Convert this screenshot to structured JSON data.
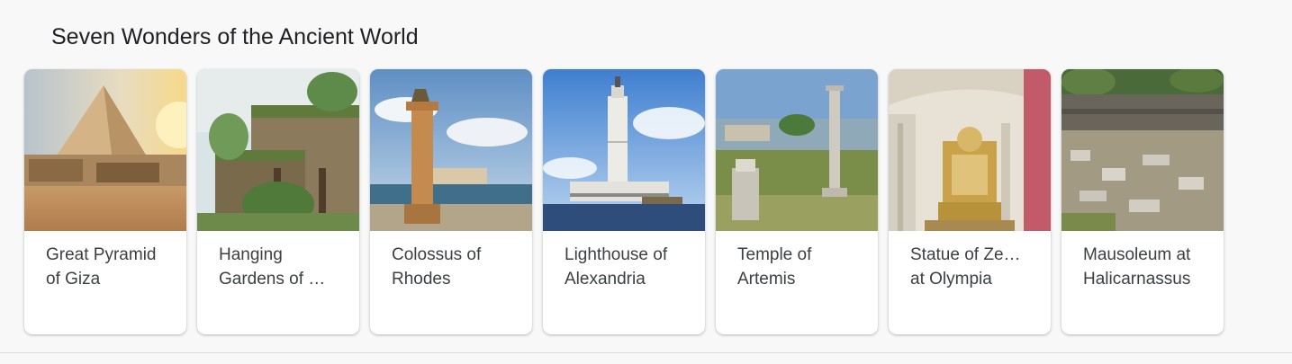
{
  "section": {
    "title": "Seven Wonders of the Ancient World"
  },
  "cards": [
    {
      "line1": "Great Pyramid",
      "line2": "of Giza",
      "image": "great-pyramid-image"
    },
    {
      "line1": "Hanging",
      "line2": "Gardens of …",
      "image": "hanging-gardens-image"
    },
    {
      "line1": "Colossus of",
      "line2": "Rhodes",
      "image": "colossus-image"
    },
    {
      "line1": "Lighthouse of",
      "line2": "Alexandria",
      "image": "lighthouse-image"
    },
    {
      "line1": "Temple of",
      "line2": "Artemis",
      "image": "temple-artemis-image"
    },
    {
      "line1": "Statue of Ze…",
      "line2": "at Olympia",
      "image": "statue-zeus-image"
    },
    {
      "line1": "Mausoleum at",
      "line2": "Halicarnassus",
      "image": "mausoleum-image"
    }
  ]
}
